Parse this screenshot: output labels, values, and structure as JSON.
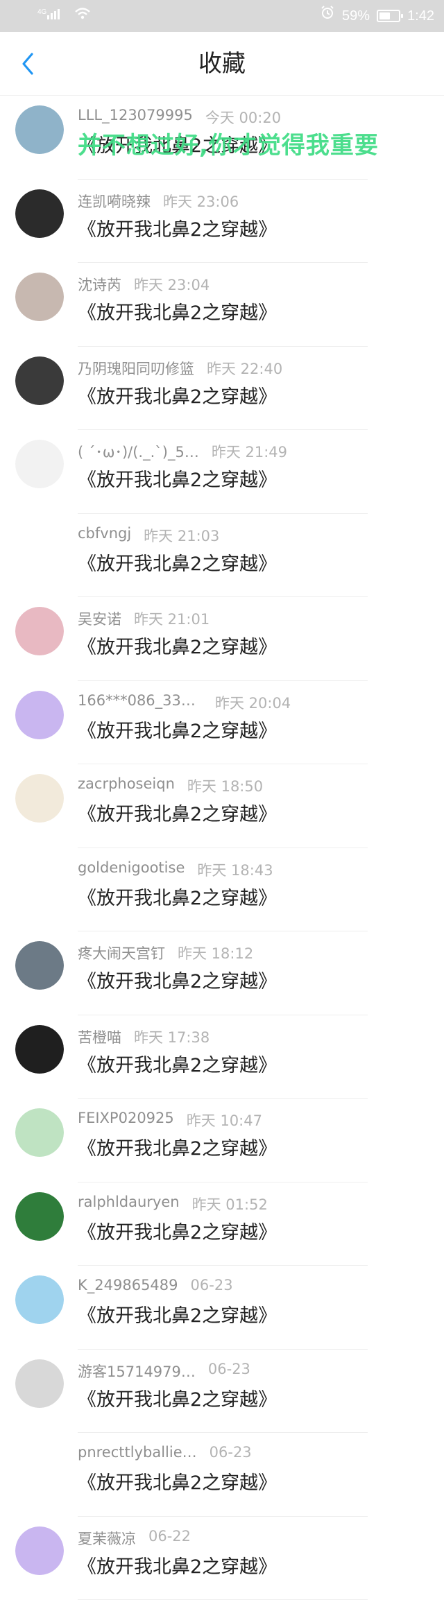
{
  "status_bar": {
    "signal_text": "4G",
    "battery_percent": "59%",
    "battery_level": 0.59,
    "time": "1:42"
  },
  "header": {
    "title": "收藏"
  },
  "overlay": {
    "text": "并不想过好,你才觉得我重要"
  },
  "items": [
    {
      "name": "LLL_123079995",
      "time": "今天 00:20",
      "title": "《放开我北鼻2之穿越》",
      "avatar_color": "#8fb3c9"
    },
    {
      "name": "连凯嗬晓辣",
      "time": "昨天 23:06",
      "title": "《放开我北鼻2之穿越》",
      "avatar_color": "#2b2b2b"
    },
    {
      "name": "沈诗芮",
      "time": "昨天 23:04",
      "title": "《放开我北鼻2之穿越》",
      "avatar_color": "#c7b8b0"
    },
    {
      "name": "乃阴瑰阳同叨修篮",
      "time": "昨天 22:40",
      "title": "《放开我北鼻2之穿越》",
      "avatar_color": "#3a3a3a"
    },
    {
      "name": "( ´･ω･)/(._.`)_5…",
      "time": "昨天 21:49",
      "title": "《放开我北鼻2之穿越》",
      "avatar_color": "#f2f2f2"
    },
    {
      "name": "cbfvngj",
      "time": "昨天 21:03",
      "title": "《放开我北鼻2之穿越》",
      "avatar_color": "#ffffff"
    },
    {
      "name": "吴安诺",
      "time": "昨天 21:01",
      "title": "《放开我北鼻2之穿越》",
      "avatar_color": "#e8b9c2"
    },
    {
      "name": "166***086_330…",
      "time": "昨天 20:04",
      "title": "《放开我北鼻2之穿越》",
      "avatar_color": "#c9b6f0"
    },
    {
      "name": "zacrphoseiqn",
      "time": "昨天 18:50",
      "title": "《放开我北鼻2之穿越》",
      "avatar_color": "#f2eadb"
    },
    {
      "name": "goldenigootise",
      "time": "昨天 18:43",
      "title": "《放开我北鼻2之穿越》",
      "avatar_color": "#ffffff"
    },
    {
      "name": "疼大闹天宫钉",
      "time": "昨天 18:12",
      "title": "《放开我北鼻2之穿越》",
      "avatar_color": "#6c7a86"
    },
    {
      "name": "苦橙喵",
      "time": "昨天 17:38",
      "title": "《放开我北鼻2之穿越》",
      "avatar_color": "#1f1f1f"
    },
    {
      "name": "FEIXP020925",
      "time": "昨天 10:47",
      "title": "《放开我北鼻2之穿越》",
      "avatar_color": "#bfe3c2"
    },
    {
      "name": "ralphldauryen",
      "time": "昨天 01:52",
      "title": "《放开我北鼻2之穿越》",
      "avatar_color": "#2f7d3b"
    },
    {
      "name": "K_249865489",
      "time": "06-23",
      "title": "《放开我北鼻2之穿越》",
      "avatar_color": "#9fd3ee"
    },
    {
      "name": "游客15714979…",
      "time": "06-23",
      "title": "《放开我北鼻2之穿越》",
      "avatar_color": "#d8d8d8"
    },
    {
      "name": "pnrecttlyballie…",
      "time": "06-23",
      "title": "《放开我北鼻2之穿越》",
      "avatar_color": "#ffffff"
    },
    {
      "name": "夏茉薇凉",
      "time": "06-22",
      "title": "《放开我北鼻2之穿越》",
      "avatar_color": "#c9b6f0"
    }
  ]
}
